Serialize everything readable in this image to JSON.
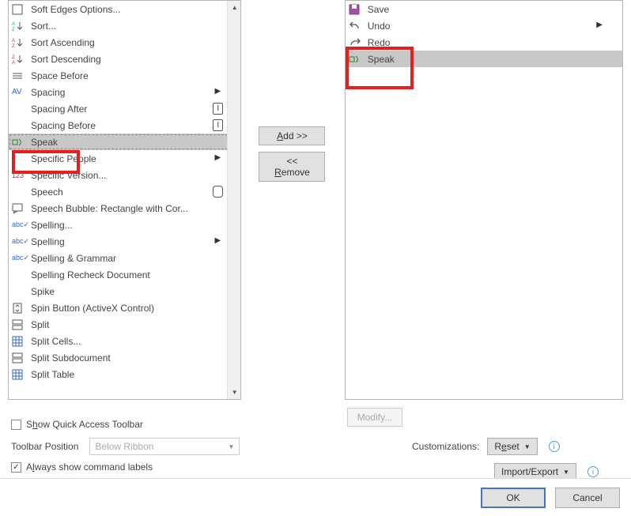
{
  "left_list": [
    {
      "icon": "square",
      "label": "Soft Edges Options..."
    },
    {
      "icon": "sortAZ",
      "label": "Sort..."
    },
    {
      "icon": "sortAsc",
      "label": "Sort Ascending"
    },
    {
      "icon": "sortDesc",
      "label": "Sort Descending"
    },
    {
      "icon": "lines",
      "label": "Space Before"
    },
    {
      "icon": "av",
      "label": "Spacing",
      "submenu": true
    },
    {
      "icon": "",
      "label": "Spacing After",
      "ibeam": true
    },
    {
      "icon": "",
      "label": "Spacing Before",
      "ibeam": true
    },
    {
      "icon": "speak",
      "label": "Speak",
      "selected": true
    },
    {
      "icon": "",
      "label": "Specific People",
      "submenu": true
    },
    {
      "icon": "ver",
      "label": "Specific Version..."
    },
    {
      "icon": "",
      "label": "Speech",
      "circle": true
    },
    {
      "icon": "bubble",
      "label": "Speech Bubble: Rectangle with Cor..."
    },
    {
      "icon": "abc",
      "label": "Spelling..."
    },
    {
      "icon": "abc",
      "label": "Spelling",
      "submenu": true
    },
    {
      "icon": "abc",
      "label": "Spelling & Grammar"
    },
    {
      "icon": "",
      "label": "Spelling Recheck Document"
    },
    {
      "icon": "",
      "label": "Spike"
    },
    {
      "icon": "spin",
      "label": "Spin Button (ActiveX Control)"
    },
    {
      "icon": "split",
      "label": "Split"
    },
    {
      "icon": "table",
      "label": "Split Cells..."
    },
    {
      "icon": "splitsub",
      "label": "Split Subdocument"
    },
    {
      "icon": "table",
      "label": "Split Table"
    }
  ],
  "right_list": [
    {
      "icon": "save",
      "label": "Save"
    },
    {
      "icon": "undo",
      "label": "Undo",
      "submenu": true
    },
    {
      "icon": "redo",
      "label": "Redo"
    },
    {
      "icon": "speak",
      "label": "Speak",
      "selected": true
    }
  ],
  "middle": {
    "add": "Add >>",
    "remove": "<< Remove"
  },
  "lower": {
    "show_qat": "Show Quick Access Toolbar",
    "position_label": "Toolbar Position",
    "position_value": "Below Ribbon",
    "always_show": "Always show command labels",
    "modify": "Modify...",
    "cust_label": "Customizations:",
    "reset": "Reset",
    "impexp": "Import/Export"
  },
  "footer": {
    "ok": "OK",
    "cancel": "Cancel"
  }
}
